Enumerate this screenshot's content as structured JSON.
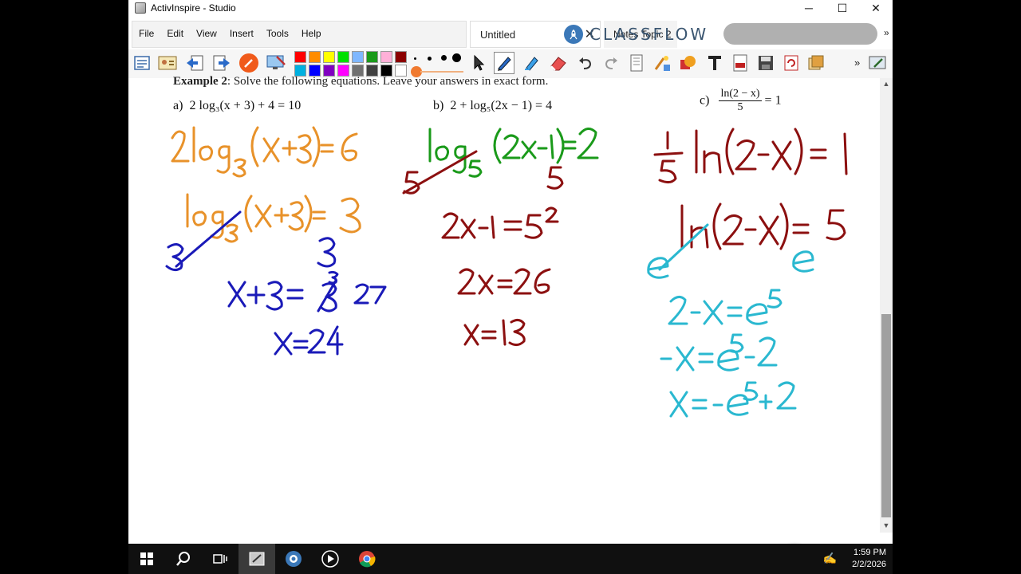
{
  "window": {
    "title": "ActivInspire - Studio",
    "controls": {
      "minimize": "─",
      "maximize": "☐",
      "close": "✕"
    }
  },
  "menu": {
    "items": [
      "File",
      "Edit",
      "View",
      "Insert",
      "Tools",
      "Help"
    ]
  },
  "tabs": {
    "active": {
      "label": "Untitled",
      "close": "✕"
    },
    "other": {
      "label": "Notes Topic 2"
    }
  },
  "classflow": {
    "brand": "CLASSFLOW",
    "more": "»"
  },
  "toolbar": {
    "palette": [
      "#ff0000",
      "#ff8c00",
      "#ffff00",
      "#00e000",
      "#7fb7ff",
      "#ffb0d8",
      "#8b0000",
      "#00b0e0",
      "#0000ff",
      "#8000c0",
      "#ff00ff",
      "#707070",
      "#202020",
      "#ffffff"
    ],
    "more": "»"
  },
  "worksheet": {
    "heading_bold": "Example 2",
    "heading_rest": ":  Solve the following equations.  Leave your answers in exact form.",
    "problem_a_label": "a)",
    "problem_a": "2 log₃(x + 3) + 4 = 10",
    "problem_b_label": "b)",
    "problem_b": "2 + log₅(2x − 1) = 4",
    "problem_c_label": "c)",
    "problem_c_num": "ln(2 − x)",
    "problem_c_den": "5",
    "problem_c_rhs": "= 1"
  },
  "ink_colors": {
    "orange": "#e8922a",
    "blue": "#1a1ab8",
    "green": "#1a9a1a",
    "darkred": "#8c1010",
    "cyan": "#2ab8d0"
  },
  "taskbar": {
    "time": "1:59 PM",
    "date": "2/2/2026"
  }
}
